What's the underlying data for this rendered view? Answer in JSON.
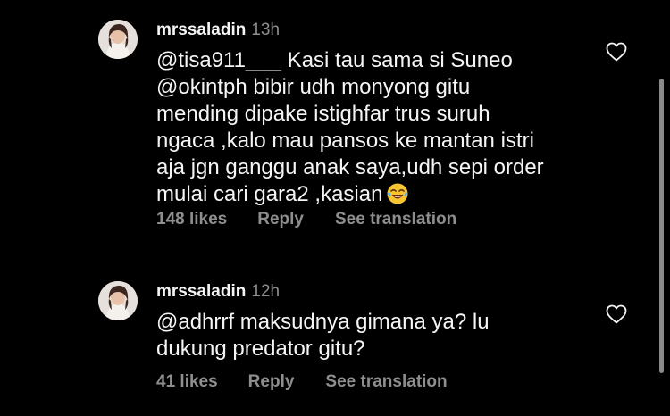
{
  "comments": [
    {
      "username": "mrssaladin",
      "time": "13h",
      "text": "@tisa911___ Kasi tau sama si Suneo\n@okintph bibir udh monyong gitu\nmending dipake istighfar trus suruh\nngaca ,kalo mau pansos ke mantan istri\naja jgn ganggu anak saya,udh sepi order\nmulai cari gara2 ,kasian",
      "emoji": "face-with-tears-of-joy-icon",
      "likes": "148 likes",
      "reply": "Reply",
      "translate": "See translation"
    },
    {
      "username": "mrssaladin",
      "time": "12h",
      "text": "@adhrrf maksudnya gimana ya? lu\ndukung predator gitu?",
      "likes": "41 likes",
      "reply": "Reply",
      "translate": "See translation"
    }
  ],
  "colors": {
    "background": "#000000",
    "text": "#f5f5f5",
    "secondary": "#8e8e8e",
    "emoji_yellow": "#f7c531"
  }
}
